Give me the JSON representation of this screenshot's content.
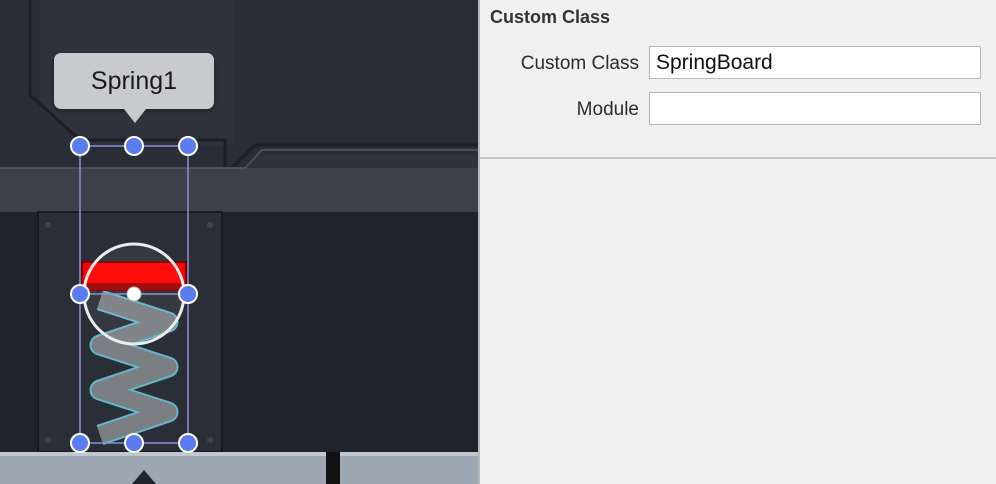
{
  "scene": {
    "node_tooltip": "Spring1"
  },
  "inspector": {
    "section_title": "Custom Class",
    "custom_class": {
      "label": "Custom Class",
      "value": "SpringBoard"
    },
    "module": {
      "label": "Module",
      "value": ""
    }
  },
  "colors": {
    "handle": "#5b7cf0",
    "selection": "#8e8fd6",
    "spring_cap": "#ff0000",
    "panel_bg": "#f0f0f0"
  }
}
